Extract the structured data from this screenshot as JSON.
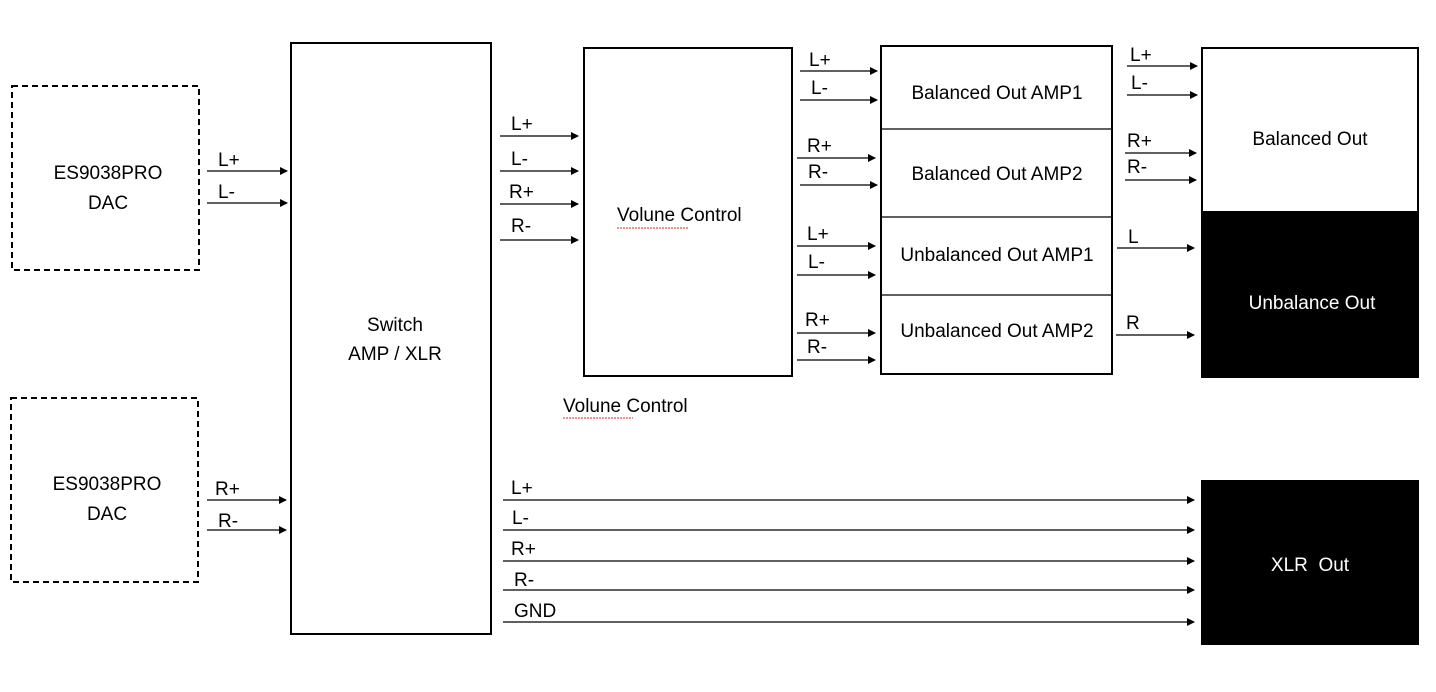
{
  "blocks": {
    "dac1": {
      "line1": "ES9038PRO",
      "line2": "DAC"
    },
    "dac2": {
      "line1": "ES9038PRO",
      "line2": "DAC"
    },
    "switch": {
      "line1": "Switch",
      "line2": "AMP / XLR"
    },
    "volume": {
      "label": "Volune Control",
      "caption": "Volune Control"
    },
    "amps": [
      "Balanced Out AMP1",
      "Balanced Out AMP2",
      "Unbalanced Out AMP1",
      "Unbalanced Out AMP2"
    ],
    "balanced_out": "Balanced Out",
    "unbalance_out": "Unbalance Out",
    "xlr_out": "XLR  Out"
  },
  "signals": {
    "dac1": [
      "L+",
      "L-"
    ],
    "dac2": [
      "R+",
      "R-"
    ],
    "volume_in": [
      "L+",
      "L-",
      "R+",
      "R-"
    ],
    "amp_in": [
      "L+",
      "L-",
      "R+",
      "R-",
      "L+",
      "L-",
      "R+",
      "R-"
    ],
    "balanced_out": [
      "L+",
      "L-",
      "R+",
      "R-"
    ],
    "unbalanced_out": [
      "L",
      "R"
    ],
    "xlr": [
      "L+",
      "L-",
      "R+",
      "R-",
      "GND"
    ]
  },
  "colors": {
    "line": "#000000",
    "filled_block": "#000000",
    "background": "#ffffff"
  }
}
